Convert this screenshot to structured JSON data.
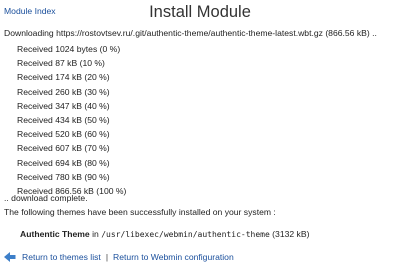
{
  "nav": {
    "module_index": "Module Index"
  },
  "header": {
    "title": "Install Module"
  },
  "download": {
    "message": "Downloading https://rostovtsev.ru/.git/authentic-theme/authentic-theme-latest.wbt.gz (866.56 kB) ..",
    "progress": [
      "Received 1024 bytes (0 %)",
      "Received 87 kB (10 %)",
      "Received 174 kB (20 %)",
      "Received 260 kB (30 %)",
      "Received 347 kB (40 %)",
      "Received 434 kB (50 %)",
      "Received 520 kB (60 %)",
      "Received 607 kB (70 %)",
      "Received 694 kB (80 %)",
      "Received 780 kB (90 %)",
      "Received 866.56 kB (100 %)"
    ],
    "complete": ".. download complete."
  },
  "install": {
    "message": "The following themes have been successfully installed on your system :",
    "theme_name": "Authentic Theme",
    "in_word": "in",
    "theme_path": "/usr/libexec/webmin/authentic-theme",
    "theme_size": "(3132 kB)"
  },
  "footer": {
    "return_themes": "Return to themes list",
    "separator": "|",
    "return_config": "Return to Webmin configuration",
    "icon": "back-arrow-icon",
    "icon_color": "#3d7fc9"
  },
  "colors": {
    "link": "#1a4f9c",
    "text": "#222222"
  }
}
